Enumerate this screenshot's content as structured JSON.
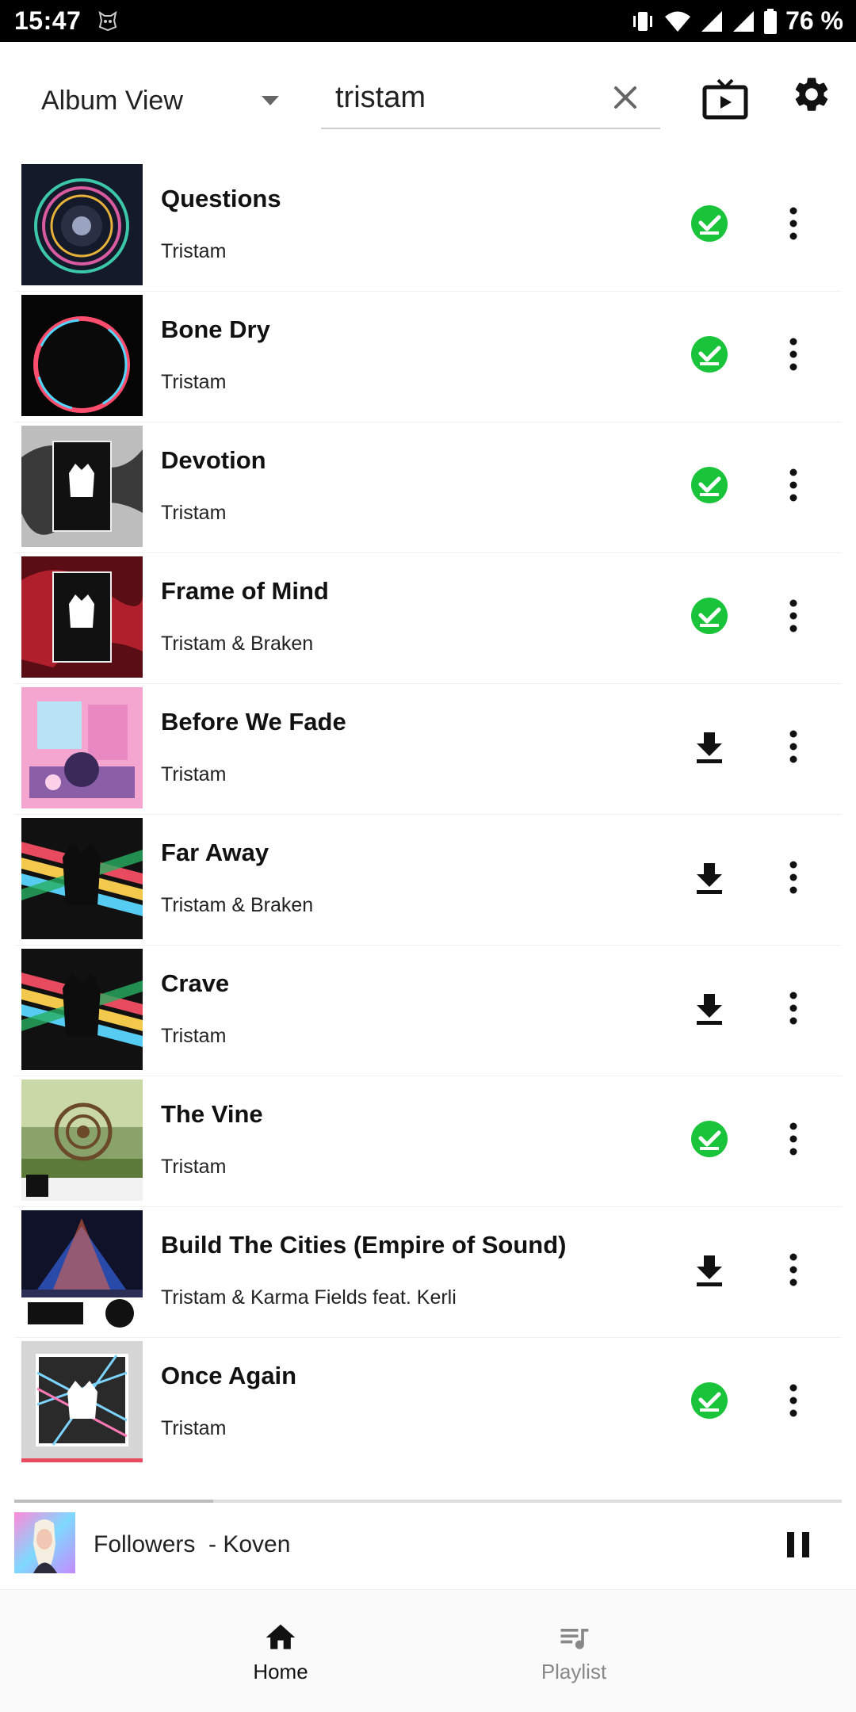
{
  "status_bar": {
    "time": "15:47",
    "battery_percent": "76 %",
    "icons": [
      "app-notification-icon",
      "vibrate-icon",
      "wifi-icon",
      "signal-icon",
      "signal-icon",
      "battery-icon"
    ]
  },
  "header": {
    "view_selector": {
      "label": "Album View",
      "icon": "caret-down-icon"
    },
    "search": {
      "value": "tristam",
      "clear_icon": "close-icon"
    },
    "cast_icon": "tv-cast-icon",
    "settings_icon": "gear-icon"
  },
  "tracks": [
    {
      "title": "Questions",
      "artist": "Tristam",
      "status": "downloaded",
      "cover_style": "best-of-2018"
    },
    {
      "title": "Bone Dry",
      "artist": "Tristam",
      "status": "downloaded",
      "cover_style": "ring-eclipse"
    },
    {
      "title": "Devotion",
      "artist": "Tristam",
      "status": "downloaded",
      "cover_style": "monstercat-grey"
    },
    {
      "title": "Frame of Mind",
      "artist": "Tristam & Braken",
      "status": "downloaded",
      "cover_style": "monstercat-red"
    },
    {
      "title": "Before We Fade",
      "artist": "Tristam",
      "status": "download",
      "cover_style": "pink-room"
    },
    {
      "title": "Far Away",
      "artist": "Tristam & Braken",
      "status": "download",
      "cover_style": "monstercat-rainbow"
    },
    {
      "title": "Crave",
      "artist": "Tristam",
      "status": "download",
      "cover_style": "monstercat-rainbow"
    },
    {
      "title": "The Vine",
      "artist": "Tristam",
      "status": "downloaded",
      "cover_style": "forest-spiral"
    },
    {
      "title": "Build The Cities (Empire of Sound)",
      "artist": "Tristam & Karma Fields feat. Kerli",
      "status": "download",
      "cover_style": "contact-022"
    },
    {
      "title": "Once Again",
      "artist": "Tristam",
      "status": "downloaded",
      "cover_style": "monstercat-silver"
    }
  ],
  "icons": {
    "downloaded": "download-done-icon",
    "download": "download-icon",
    "more": "more-vert-icon"
  },
  "colors": {
    "downloaded_green": "#19c43a",
    "status_bar": "#000000",
    "inactive_nav": "#888888"
  },
  "player": {
    "title": "Followers",
    "artist": "Koven",
    "display": "Followers  - Koven",
    "progress_fraction": 0.24,
    "pause_icon": "pause-icon"
  },
  "bottom_nav": {
    "items": [
      {
        "label": "Home",
        "icon": "home-icon",
        "active": true
      },
      {
        "label": "Playlist",
        "icon": "playlist-icon",
        "active": false
      }
    ]
  }
}
